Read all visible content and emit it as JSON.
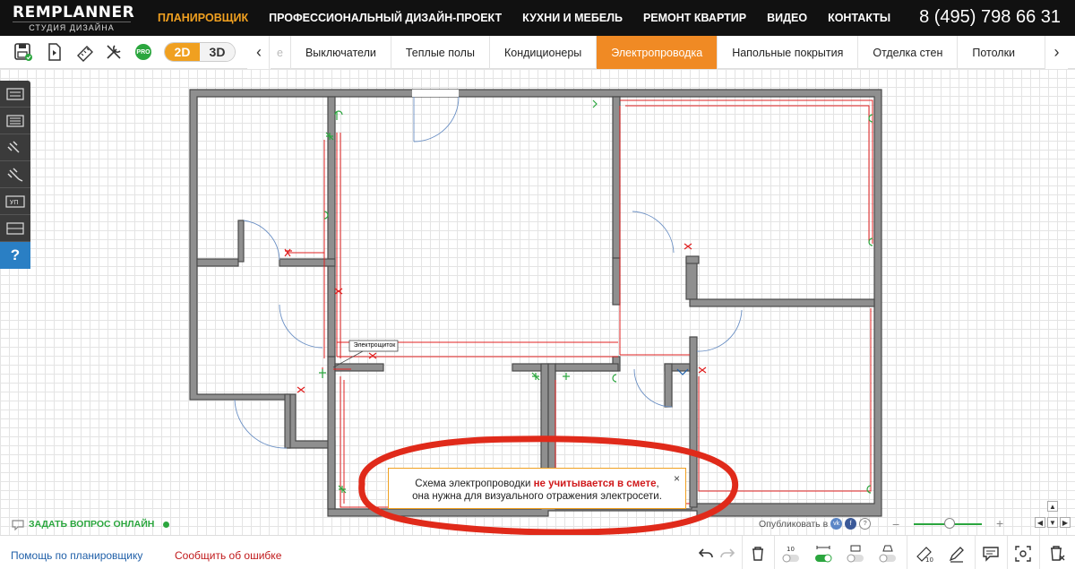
{
  "brand": {
    "name": "REMPLANNER",
    "tagline": "СТУДИЯ ДИЗАЙНА"
  },
  "nav": {
    "items": [
      "ПЛАНИРОВЩИК",
      "ПРОФЕССИОНАЛЬНЫЙ ДИЗАЙН-ПРОЕКТ",
      "КУХНИ И МЕБЕЛЬ",
      "РЕМОНТ КВАРТИР",
      "ВИДЕО",
      "КОНТАКТЫ"
    ],
    "active": "ПЛАНИРОВЩИК",
    "phone": "8 (495) 798 66 31"
  },
  "toolbar": {
    "icons": [
      "save-icon",
      "import-icon",
      "measure-icon",
      "tools-icon",
      "pro-icon"
    ],
    "pro_label": "PRO",
    "view_2d": "2D",
    "view_3d": "3D",
    "view_active": "2D"
  },
  "tabs": {
    "items": [
      "Выключатели",
      "Теплые полы",
      "Кондиционеры",
      "Электропроводка",
      "Напольные покрытия",
      "Отделка стен",
      "Потолки"
    ],
    "active": "Электропроводка"
  },
  "plan": {
    "panel_label": "Электрощиток"
  },
  "notice": {
    "text_before": "Схема электропроводки ",
    "text_highlight": "не учитывается в смете",
    "text_after": ", она нужна для визуального отражения электросети.",
    "close": "×"
  },
  "left_tools": [
    "socket-tool-icon",
    "socket-double-icon",
    "plug-icon",
    "plug-double-icon",
    "labeled-box-icon",
    "box-icon"
  ],
  "left_tools_help": "?",
  "status": {
    "ask_online": "ЗАДАТЬ ВОПРОС ОНЛАЙН",
    "publish_label": "Опубликовать в",
    "social": [
      "vk",
      "f",
      "?"
    ]
  },
  "footer": {
    "help_link": "Помощь по планировщику",
    "report_link": "Сообщить об ошибке",
    "toggle_count_label": "10"
  },
  "colors": {
    "accent": "#f0a020",
    "active_tab": "#f08a24",
    "wiring": "#e02020",
    "socket_green": "#2ba63e",
    "wall": "#6b6b6b",
    "annotation": "#e02a1a"
  }
}
